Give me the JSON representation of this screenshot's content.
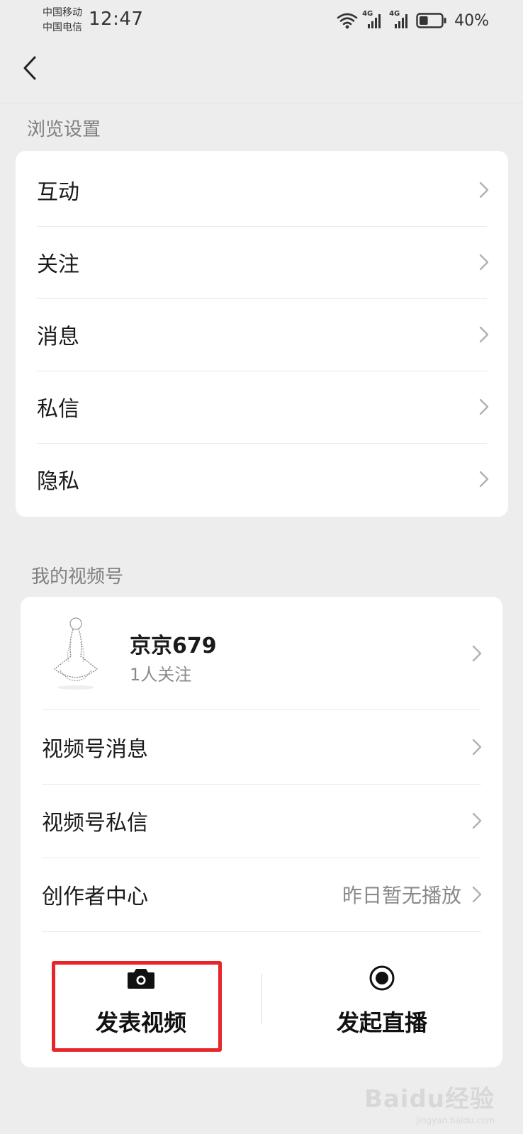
{
  "status_bar": {
    "carrier_1": "中国移动",
    "carrier_2": "中国电信",
    "time": "12:47",
    "signal_1_label": "4G",
    "signal_2_label": "4G",
    "battery_percent": "40%",
    "battery_level": 0.4
  },
  "nav": {
    "back_icon": "chevron-left-icon"
  },
  "browse_settings": {
    "section_title": "浏览设置",
    "items": [
      {
        "label": "互动"
      },
      {
        "label": "关注"
      },
      {
        "label": "消息"
      },
      {
        "label": "私信"
      },
      {
        "label": "隐私"
      }
    ]
  },
  "channels": {
    "section_title": "我的视频号",
    "profile": {
      "name": "京京679",
      "followers": "1人关注"
    },
    "items": [
      {
        "label": "视频号消息",
        "value": ""
      },
      {
        "label": "视频号私信",
        "value": ""
      },
      {
        "label": "创作者中心",
        "value": "昨日暂无播放"
      }
    ],
    "actions": {
      "post_video": {
        "label": "发表视频",
        "icon": "camera-icon"
      },
      "go_live": {
        "label": "发起直播",
        "icon": "live-record-icon"
      }
    },
    "highlight_color": "#e8262a"
  },
  "watermark": {
    "logo": "Baidu经验",
    "url": "jingyan.baidu.com"
  }
}
